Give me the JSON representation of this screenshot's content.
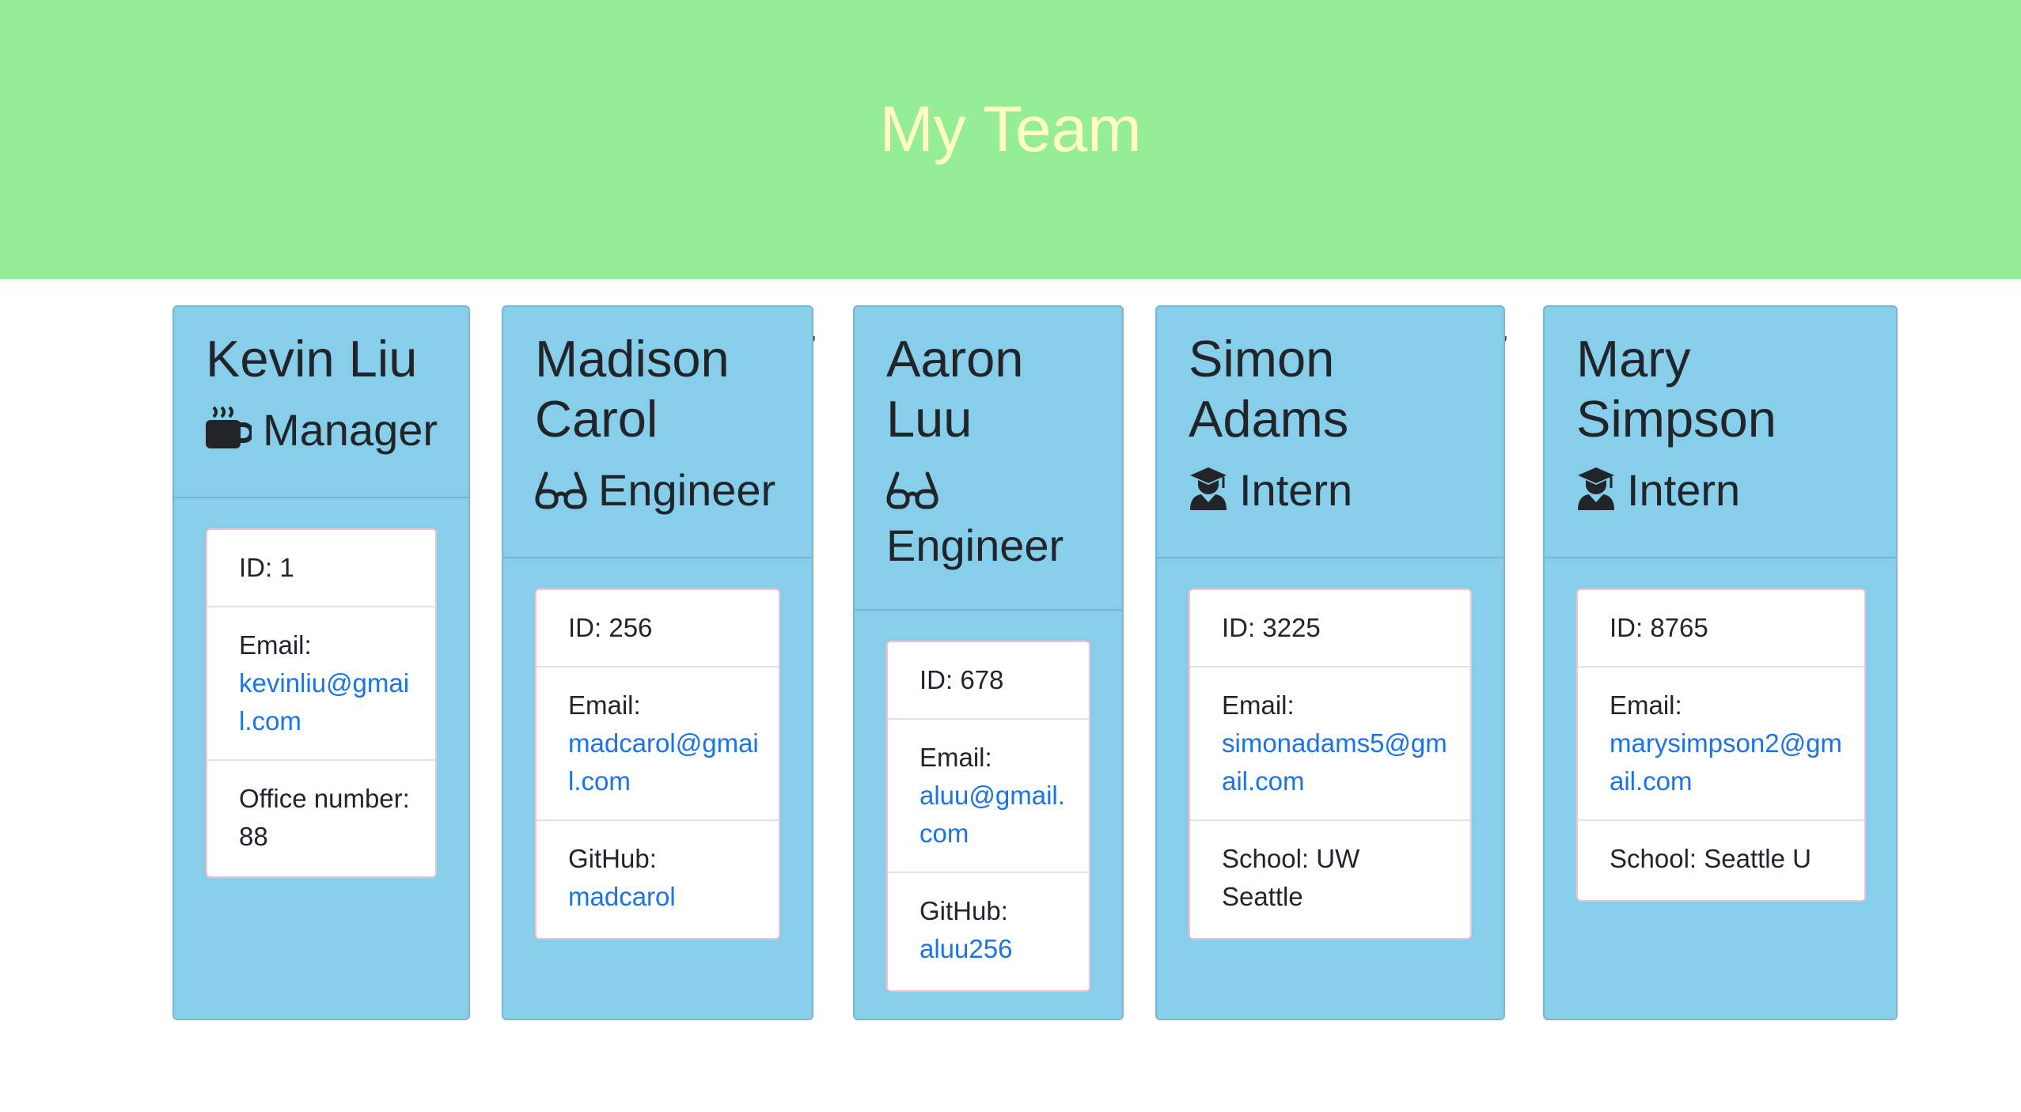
{
  "header": {
    "title": "My Team"
  },
  "colors": {
    "header_bg": "#95ee95",
    "title": "#ffffc4",
    "card_bg": "#87ceea",
    "link": "#1a73e8"
  },
  "employees": [
    {
      "name": "Kevin Liu",
      "role": "Manager",
      "role_icon": "coffee-mug-icon",
      "id_text": "ID: 1",
      "email_label": "Email:",
      "email": "kevinliu@gmail.com",
      "extra_label": "Office number: 88",
      "extra_value": ""
    },
    {
      "name": "Madison Carol",
      "role": "Engineer",
      "role_icon": "glasses-icon",
      "id_text": "ID: 256",
      "email_label": "Email:",
      "email": "madcarol@gmail.com",
      "extra_label": "GitHub:",
      "extra_value": "madcarol"
    },
    {
      "name": "Aaron Luu",
      "role": "Engineer",
      "role_icon": "glasses-icon",
      "id_text": "ID: 678",
      "email_label": "Email:",
      "email": "aluu@gmail.com",
      "extra_label": "GitHub:",
      "extra_value": "aluu256"
    },
    {
      "name": "Simon Adams",
      "role": "Intern",
      "role_icon": "graduate-icon",
      "id_text": "ID: 3225",
      "email_label": "Email:",
      "email": "simonadams5@gmail.com",
      "extra_label": "School: UW Seattle",
      "extra_value": ""
    },
    {
      "name": "Mary Simpson",
      "role": "Intern",
      "role_icon": "graduate-icon",
      "id_text": "ID: 8765",
      "email_label": "Email:",
      "email": "marysimpson2@gmail.com",
      "extra_label": "School: Seattle U",
      "extra_value": ""
    }
  ]
}
